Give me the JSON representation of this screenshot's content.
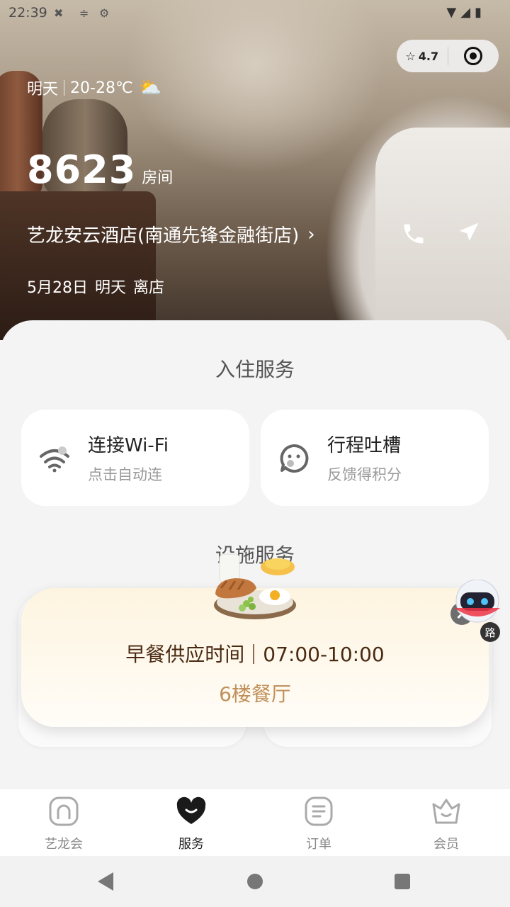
{
  "status_bar": {
    "time": "22:39"
  },
  "capsule": {
    "rating": "4.7"
  },
  "weather": {
    "day": "明天",
    "temp": "20-28℃"
  },
  "room": {
    "number": "8623",
    "unit": "房间"
  },
  "hotel": {
    "name": "艺龙安云酒店(南通先锋金融街店)"
  },
  "stay": {
    "date": "5月28日",
    "day": "明天",
    "action": "离店"
  },
  "checkin_services": {
    "title": "入住服务",
    "items": [
      {
        "title": "连接Wi-Fi",
        "subtitle": "点击自动连"
      },
      {
        "title": "行程吐槽",
        "subtitle": "反馈得积分"
      }
    ]
  },
  "facility_services": {
    "title": "设施服务"
  },
  "breakfast_popup": {
    "label": "早餐供应时间",
    "time": "07:00-10:00",
    "location": "6楼餐厅"
  },
  "robot": {
    "label": "路"
  },
  "tabs": [
    {
      "label": "艺龙会",
      "icon": "home-arch-icon"
    },
    {
      "label": "服务",
      "icon": "smile-heart-icon",
      "active": true
    },
    {
      "label": "订单",
      "icon": "order-list-icon"
    },
    {
      "label": "会员",
      "icon": "member-crown-icon"
    }
  ]
}
